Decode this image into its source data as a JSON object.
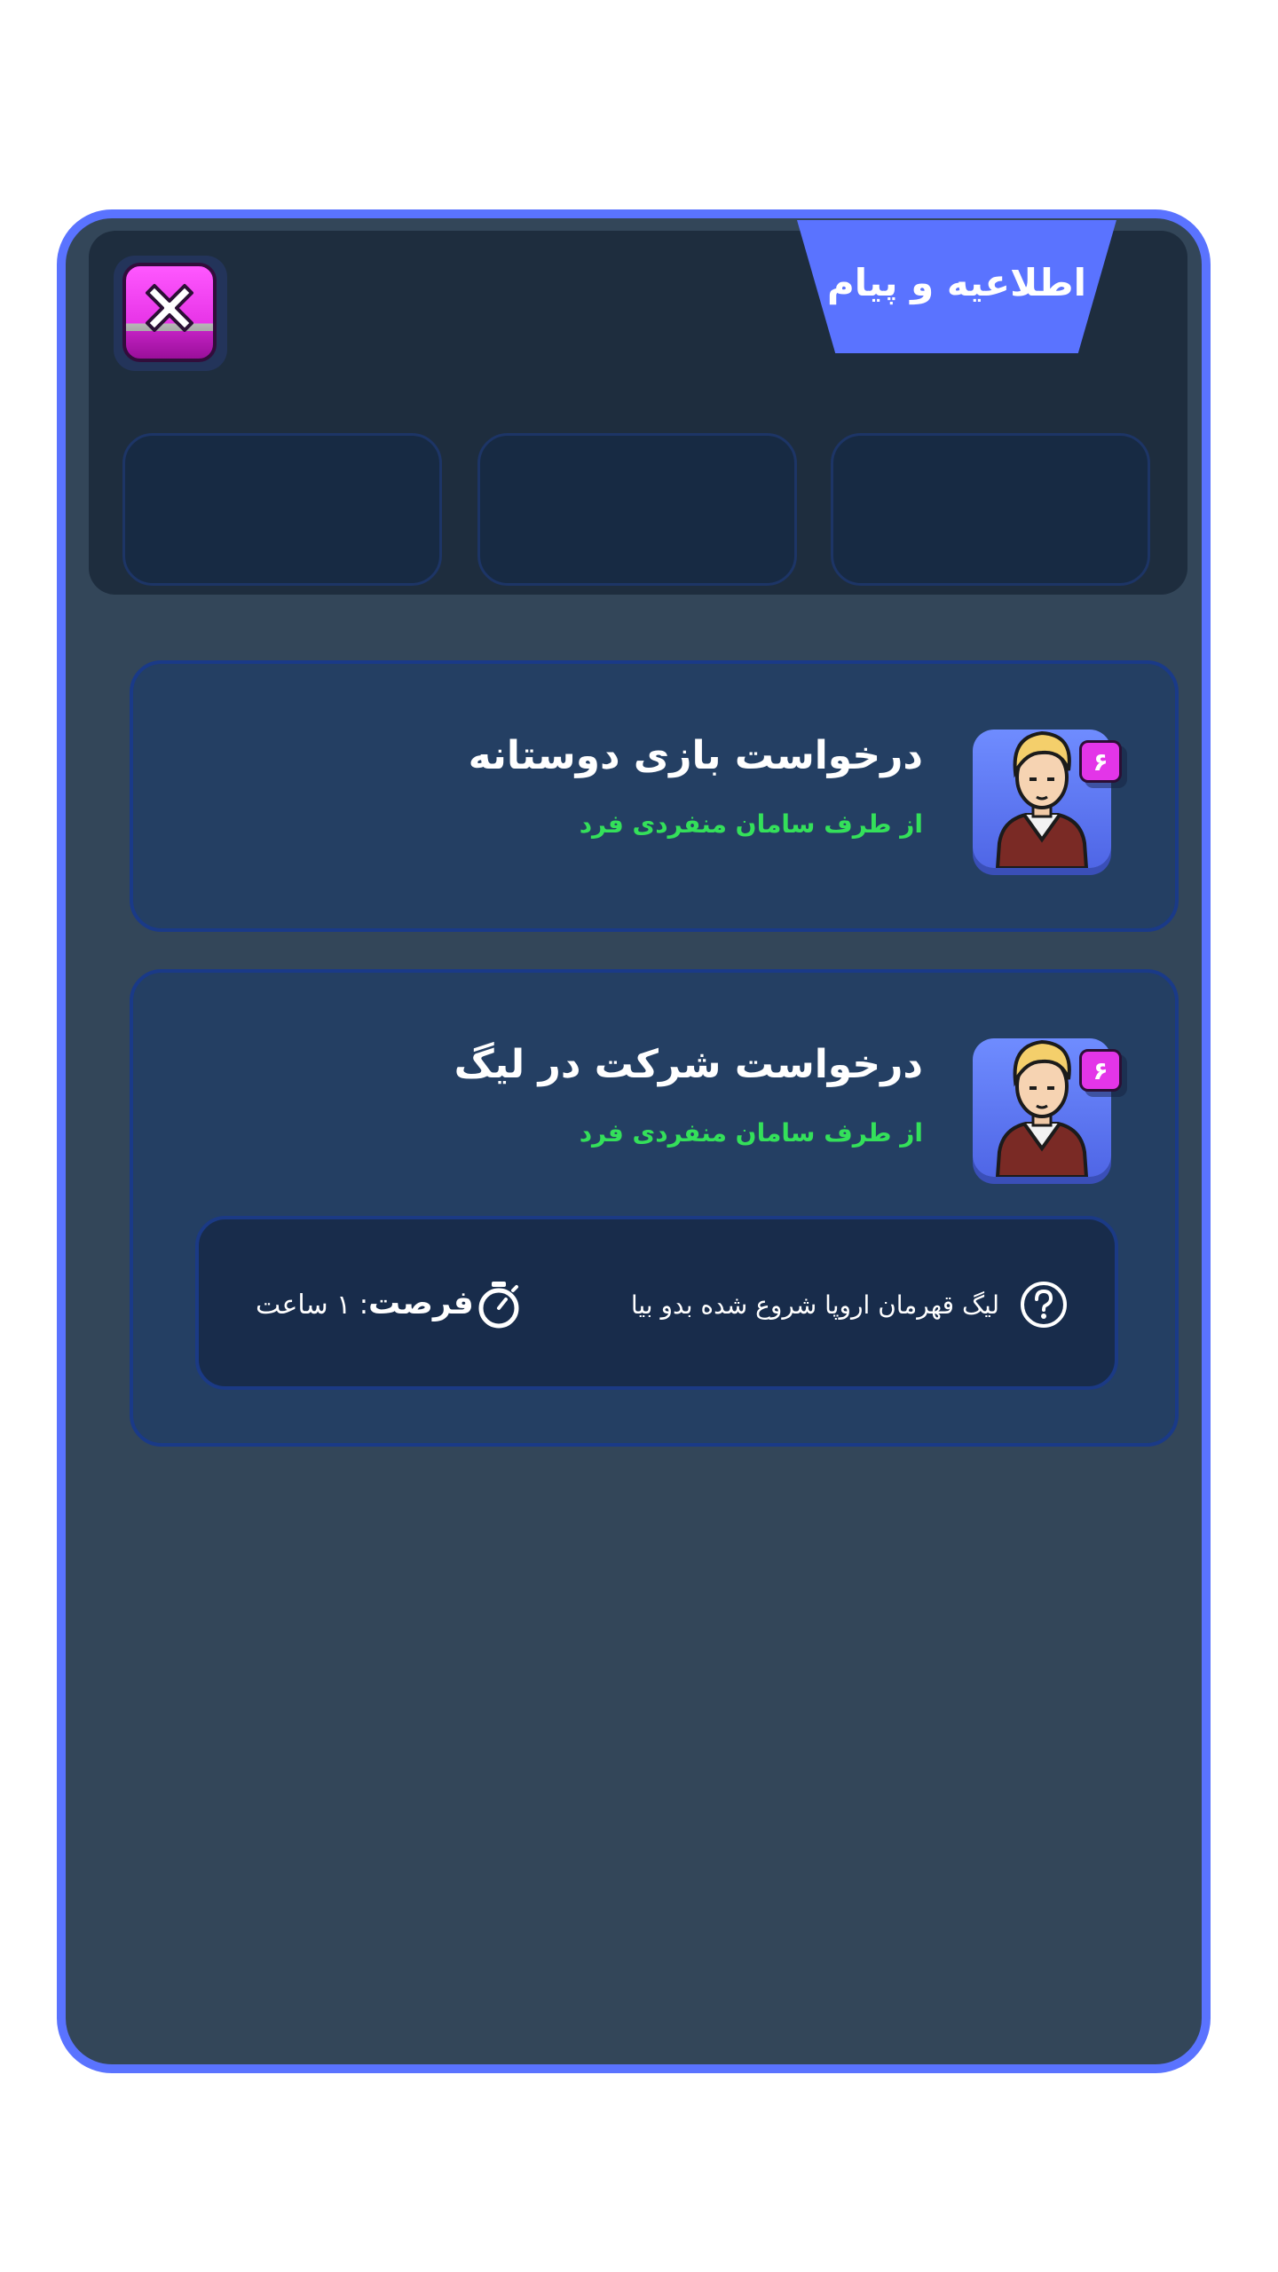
{
  "panel": {
    "title": "اطلاعیه و پیام"
  },
  "header": {
    "tabs": [
      "",
      "",
      ""
    ]
  },
  "notifications": [
    {
      "title": "درخواست بازی دوستانه",
      "from": "از طرف سامان منفردی فرد",
      "level": "۶"
    },
    {
      "title": "درخواست شرکت در لیگ",
      "from": "از طرف سامان منفردی فرد",
      "level": "۶",
      "info": {
        "message": "لیگ قهرمان اروپا شروع شده بدو بیا",
        "deadline_label": "فرصت",
        "deadline_value": ": ۱ ساعت"
      }
    }
  ],
  "icons": {
    "close": "close-x-icon",
    "help": "question-circle-icon",
    "timer": "stopwatch-icon"
  },
  "colors": {
    "accent": "#5a73ff",
    "panel_bg": "#334659",
    "green": "#34e05a",
    "pink": "#e335e8"
  }
}
